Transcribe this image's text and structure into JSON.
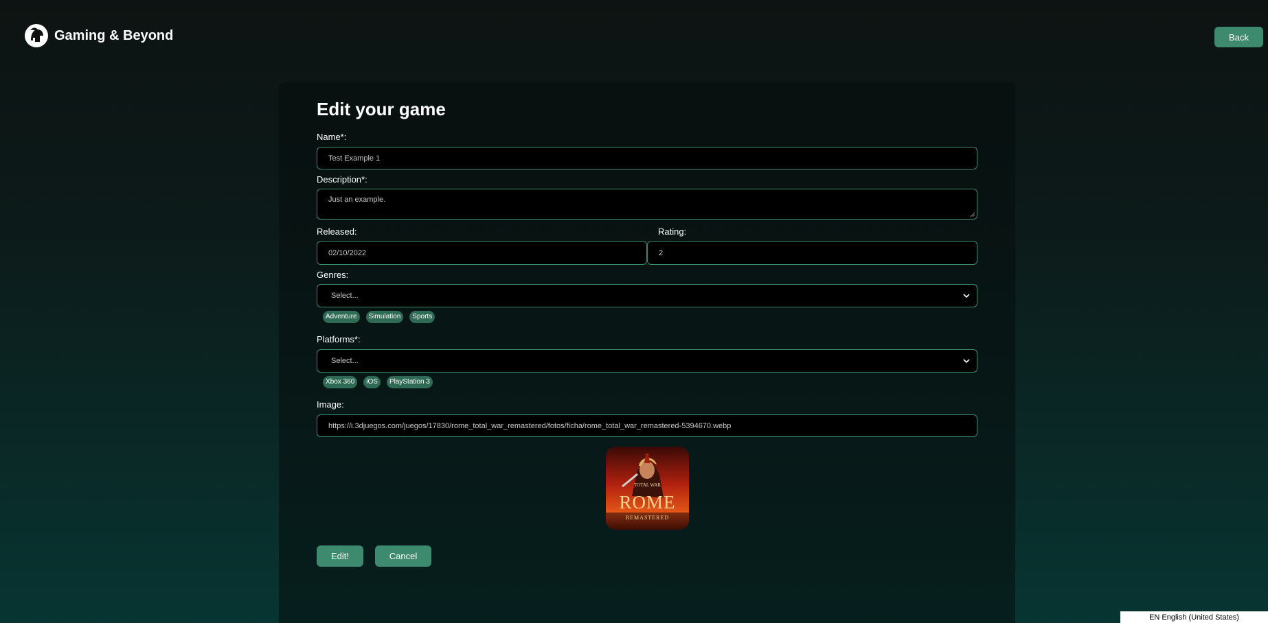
{
  "brand": {
    "title": "Gaming & Beyond",
    "logo_icon": "spartan-helmet-icon"
  },
  "header": {
    "back_label": "Back"
  },
  "form": {
    "title": "Edit your game",
    "name": {
      "label": "Name*:",
      "value": "Test Example 1"
    },
    "description": {
      "label": "Description*:",
      "value": "Just an example."
    },
    "released": {
      "label": "Released:",
      "value": "02/10/2022"
    },
    "rating": {
      "label": "Rating:",
      "value": "2"
    },
    "genres": {
      "label": "Genres:",
      "placeholder": "Select...",
      "selected": [
        "Adventure",
        "Simulation",
        "Sports"
      ]
    },
    "platforms": {
      "label": "Platforms*:",
      "placeholder": "Select...",
      "selected": [
        "Xbox 360",
        "iOS",
        "PlayStation 3"
      ]
    },
    "image": {
      "label": "Image:",
      "value": "https://i.3djuegos.com/juegos/17830/rome_total_war_remastered/fotos/ficha/rome_total_war_remastered-5394670.webp",
      "preview": {
        "top_text": "TOTAL WAR",
        "main_text": "ROME",
        "sub_text": "REMASTERED"
      }
    },
    "edit_label": "Edit!",
    "cancel_label": "Cancel"
  },
  "language_bar": {
    "text": "EN English (United States)"
  },
  "colors": {
    "accent": "#3e8a6e",
    "chip": "#2f6a55",
    "field_border": "#3c8a6e",
    "field_bg": "#000000"
  }
}
